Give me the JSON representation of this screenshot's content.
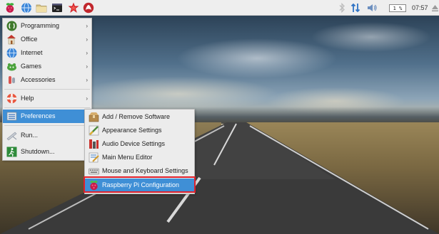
{
  "taskbar": {
    "launchers": [
      {
        "name": "raspberry-menu-icon"
      },
      {
        "name": "web-browser-icon"
      },
      {
        "name": "file-manager-icon"
      },
      {
        "name": "terminal-icon"
      },
      {
        "name": "wolfram-icon"
      },
      {
        "name": "mathematica-icon"
      }
    ],
    "tray": {
      "bluetooth_icon": "bluetooth-icon",
      "network_icon": "network-arrows-icon",
      "volume_icon": "volume-icon",
      "cpu_usage": "1 %",
      "clock": "07:57",
      "eject_icon": "eject-icon"
    }
  },
  "main_menu": {
    "items": [
      {
        "label": "Programming",
        "icon": "programming-icon",
        "submenu": true
      },
      {
        "label": "Office",
        "icon": "office-icon",
        "submenu": true
      },
      {
        "label": "Internet",
        "icon": "internet-globe-icon",
        "submenu": true
      },
      {
        "label": "Games",
        "icon": "games-icon",
        "submenu": true
      },
      {
        "label": "Accessories",
        "icon": "accessories-icon",
        "submenu": true
      },
      {
        "label": "Help",
        "icon": "help-lifebuoy-icon",
        "submenu": true
      },
      {
        "label": "Preferences",
        "icon": "preferences-icon",
        "submenu": true,
        "selected": true
      },
      {
        "label": "Run...",
        "icon": "run-icon",
        "submenu": false
      },
      {
        "label": "Shutdown...",
        "icon": "shutdown-icon",
        "submenu": false
      }
    ],
    "submenu_arrow": "›"
  },
  "preferences_menu": {
    "items": [
      {
        "label": "Add / Remove Software",
        "icon": "add-remove-software-icon"
      },
      {
        "label": "Appearance Settings",
        "icon": "appearance-settings-icon"
      },
      {
        "label": "Audio Device Settings",
        "icon": "audio-device-settings-icon"
      },
      {
        "label": "Main Menu Editor",
        "icon": "main-menu-editor-icon"
      },
      {
        "label": "Mouse and Keyboard Settings",
        "icon": "mouse-keyboard-settings-icon"
      },
      {
        "label": "Raspberry Pi Configuration",
        "icon": "raspberry-pi-config-icon",
        "selected": true
      }
    ]
  },
  "colors": {
    "selection": "#3f8fd6",
    "highlight_border": "#e0202a",
    "menu_bg": "#ececec",
    "taskbar_bg": "#eeeeee"
  }
}
